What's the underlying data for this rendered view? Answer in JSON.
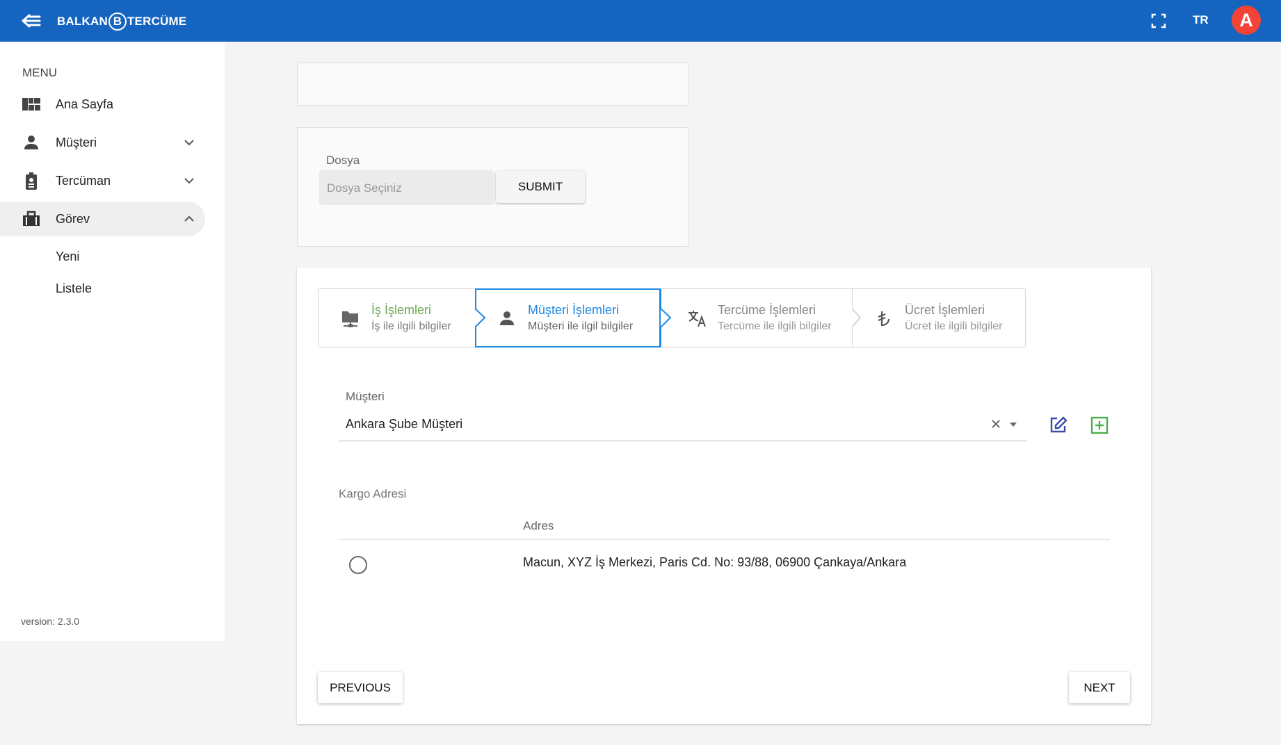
{
  "header": {
    "logo_left": "BALKAN",
    "logo_mark": "B",
    "logo_right": "TERCÜME",
    "language": "TR",
    "avatar_letter": "A",
    "bar_color": "#1565c0"
  },
  "sidebar": {
    "menu_title": "MENU",
    "items": [
      {
        "label": "Ana Sayfa",
        "icon": "dashboard-icon"
      },
      {
        "label": "Müşteri",
        "icon": "person-icon"
      },
      {
        "label": "Tercüman",
        "icon": "badge-icon"
      },
      {
        "label": "Görev",
        "icon": "briefcase-icon"
      }
    ],
    "subitems": [
      "Yeni",
      "Listele"
    ],
    "version": "version: 2.3.0"
  },
  "upload": {
    "label": "Dosya",
    "placeholder": "Dosya Seçiniz",
    "submit": "SUBMIT"
  },
  "stepper": {
    "steps": [
      {
        "title": "İş İşlemleri",
        "subtitle": "İş ile ilgili bilgiler",
        "icon": "folder-network-icon",
        "state": "completed",
        "color": "#6aa84f"
      },
      {
        "title": "Müşteri İşlemleri",
        "subtitle": "Müşteri ile ilgil bilgiler",
        "icon": "person-icon",
        "state": "active",
        "color": "#1e88e5"
      },
      {
        "title": "Tercüme İşlemleri",
        "subtitle": "Tercüme ile ilgili bilgiler",
        "icon": "translate-icon",
        "state": "pending",
        "color": "#888888"
      },
      {
        "title": "Ücret İşlemleri",
        "subtitle": "Ücret ile ilgili bilgiler",
        "icon": "lira-icon",
        "state": "pending",
        "color": "#888888"
      }
    ]
  },
  "customer": {
    "label": "Müşteri",
    "value": "Ankara Şube Müşteri"
  },
  "cargo": {
    "label": "Kargo Adresi",
    "column": "Adres",
    "rows": [
      {
        "address": "Macun, XYZ İş Merkezi, Paris Cd. No: 93/88, 06900 Çankaya/Ankara",
        "selected": false
      }
    ]
  },
  "footer": {
    "previous": "PREVIOUS",
    "next": "NEXT"
  }
}
